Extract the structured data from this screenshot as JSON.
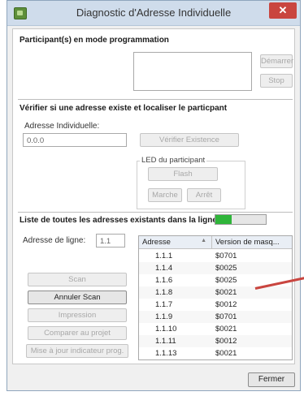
{
  "window": {
    "title": "Diagnostic d'Adresse Individuelle",
    "close": "✕"
  },
  "section1": {
    "title": "Participant(s) en mode programmation",
    "start_label": "Démarrer",
    "stop_label": "Stop"
  },
  "section2": {
    "title": "Vérifier si une adresse existe et localiser le particpant",
    "address_label": "Adresse Individuelle:",
    "address_value": "0.0.0",
    "verify_label": "Vérifier  Existence",
    "led_group_label": "LED du participant",
    "flash_label": "Flash",
    "on_label": "Marche",
    "off_label": "Arrêt"
  },
  "section3": {
    "title": "Liste de toutes les adresses existants dans la ligne",
    "progress": 0.32,
    "line_label": "Adresse de ligne:",
    "line_value": "1.1",
    "buttons": {
      "scan": "Scan",
      "cancel_scan": "Annuler Scan",
      "print": "Impression",
      "compare": "Comparer au projet",
      "update": "Mise à jour indicateur prog."
    },
    "table": {
      "headers": [
        "Adresse",
        "Version de masq..."
      ],
      "rows": [
        [
          "1.1.1",
          "$0701"
        ],
        [
          "1.1.4",
          "$0025"
        ],
        [
          "1.1.6",
          "$0025"
        ],
        [
          "1.1.8",
          "$0021"
        ],
        [
          "1.1.7",
          "$0012"
        ],
        [
          "1.1.9",
          "$0701"
        ],
        [
          "1.1.10",
          "$0021"
        ],
        [
          "1.1.11",
          "$0012"
        ],
        [
          "1.1.13",
          "$0021"
        ]
      ]
    }
  },
  "footer": {
    "close_label": "Fermer"
  },
  "colors": {
    "progress_fill": "#2fb53a",
    "close_button": "#c9453f",
    "arrow": "#c9453f"
  }
}
